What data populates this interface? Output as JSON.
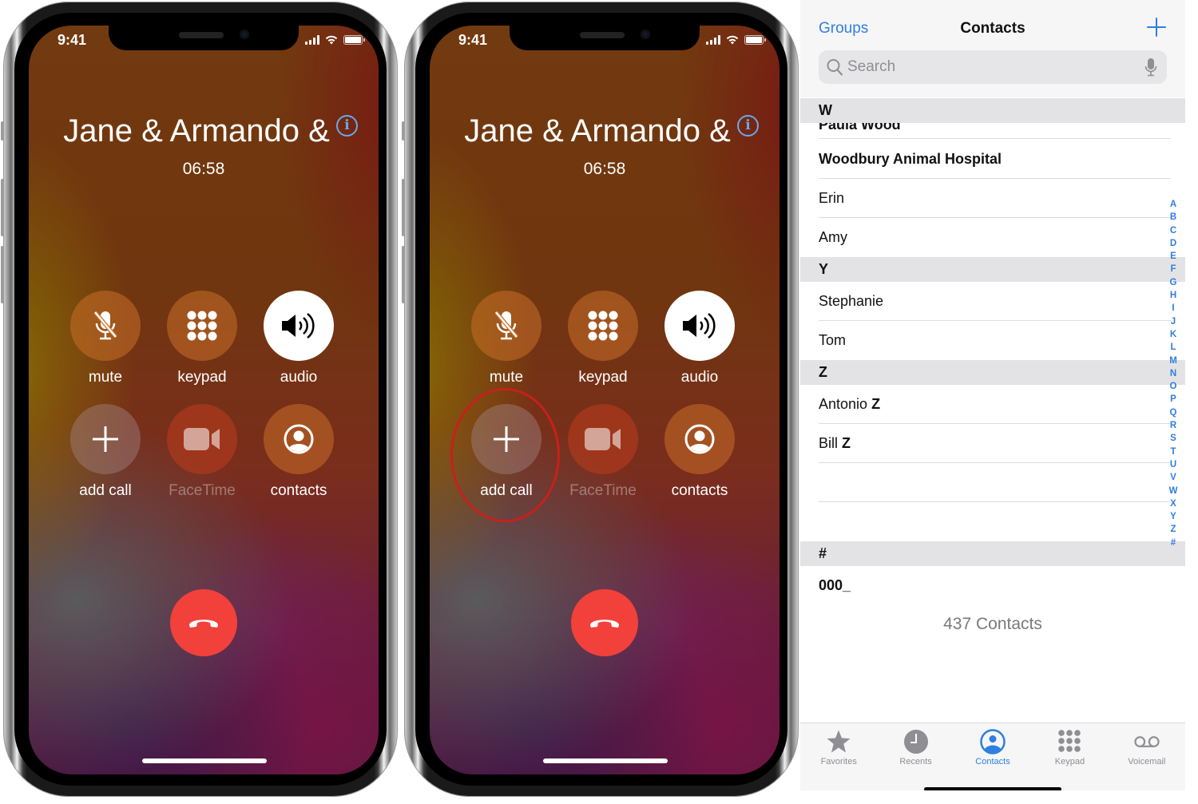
{
  "call_screens": [
    {
      "status_time": "9:41",
      "caller": "Jane & Armando &",
      "timer": "06:58",
      "controls": [
        {
          "id": "mute",
          "label": "mute",
          "icon": "mic-slash-icon",
          "enabled": true
        },
        {
          "id": "keypad",
          "label": "keypad",
          "icon": "keypad-icon",
          "enabled": true
        },
        {
          "id": "audio",
          "label": "audio",
          "icon": "speaker-icon",
          "enabled": true,
          "active": true
        },
        {
          "id": "add_call",
          "label": "add call",
          "icon": "plus-icon",
          "enabled": true
        },
        {
          "id": "facetime",
          "label": "FaceTime",
          "icon": "video-camera-icon",
          "enabled": false
        },
        {
          "id": "contacts",
          "label": "contacts",
          "icon": "person-circle-icon",
          "enabled": true
        }
      ],
      "end_call_icon": "phone-hangup-icon"
    },
    {
      "status_time": "9:41",
      "caller": "Jane & Armando &",
      "timer": "06:58",
      "controls": [
        {
          "id": "mute",
          "label": "mute",
          "icon": "mic-slash-icon",
          "enabled": true
        },
        {
          "id": "keypad",
          "label": "keypad",
          "icon": "keypad-icon",
          "enabled": true
        },
        {
          "id": "audio",
          "label": "audio",
          "icon": "speaker-icon",
          "enabled": true,
          "active": true
        },
        {
          "id": "add_call",
          "label": "add call",
          "icon": "plus-icon",
          "enabled": true,
          "highlighted": true
        },
        {
          "id": "facetime",
          "label": "FaceTime",
          "icon": "video-camera-icon",
          "enabled": false
        },
        {
          "id": "contacts",
          "label": "contacts",
          "icon": "person-circle-icon",
          "enabled": true
        }
      ],
      "end_call_icon": "phone-hangup-icon"
    }
  ],
  "contacts_screen": {
    "groups_label": "Groups",
    "title": "Contacts",
    "add_icon": "plus-icon",
    "search": {
      "placeholder": "Search",
      "value": ""
    },
    "sections": [
      {
        "letter": "W",
        "rows": [
          {
            "first": "Paula ",
            "last": "Wood",
            "partial": true
          },
          {
            "first": "",
            "last": "Woodbury Animal Hospital"
          },
          {
            "first": "Erin",
            "last": ""
          },
          {
            "first": "Amy",
            "last": ""
          }
        ]
      },
      {
        "letter": "Y",
        "rows": [
          {
            "first": "Stephanie",
            "last": ""
          },
          {
            "first": "Tom",
            "last": ""
          }
        ]
      },
      {
        "letter": "Z",
        "rows": [
          {
            "first": "Antonio ",
            "last": "Z"
          },
          {
            "first": "Bill ",
            "last": "Z"
          },
          {
            "first": "",
            "last": ""
          }
        ]
      },
      {
        "letter": "#",
        "rows": [
          {
            "first": "",
            "last": "000_"
          }
        ]
      }
    ],
    "index_letters": [
      "A",
      "B",
      "C",
      "D",
      "E",
      "F",
      "G",
      "H",
      "I",
      "J",
      "K",
      "L",
      "M",
      "N",
      "O",
      "P",
      "Q",
      "R",
      "S",
      "T",
      "U",
      "V",
      "W",
      "X",
      "Y",
      "Z",
      "#"
    ],
    "count_label": "437 Contacts",
    "tabs": [
      {
        "label": "Favorites",
        "icon": "star-icon",
        "active": false
      },
      {
        "label": "Recents",
        "icon": "clock-icon",
        "active": false
      },
      {
        "label": "Contacts",
        "icon": "person-circle-icon",
        "active": true
      },
      {
        "label": "Keypad",
        "icon": "keypad-icon",
        "active": false
      },
      {
        "label": "Voicemail",
        "icon": "voicemail-icon",
        "active": false
      }
    ]
  },
  "colors": {
    "accent_blue": "#2f7ee0",
    "end_call_red": "#f2413a",
    "highlight_ring": "#c8201a"
  }
}
